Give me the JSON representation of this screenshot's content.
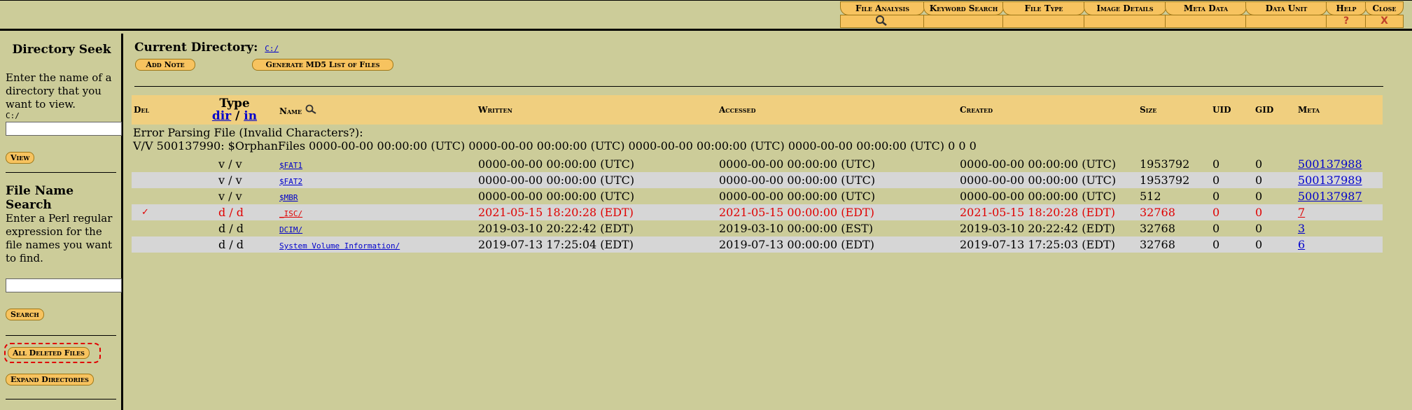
{
  "tabs": [
    {
      "label": "File Analysis",
      "sub": "search-icon"
    },
    {
      "label": "Keyword Search",
      "sub": ""
    },
    {
      "label": "File Type",
      "sub": ""
    },
    {
      "label": "Image Details",
      "sub": ""
    },
    {
      "label": "Meta Data",
      "sub": ""
    },
    {
      "label": "Data Unit",
      "sub": ""
    },
    {
      "label": "Help",
      "sub": "?"
    },
    {
      "label": "Close",
      "sub": "X"
    }
  ],
  "left": {
    "dir_seek_title": "Directory Seek",
    "dir_seek_text": "Enter the name of a directory that you want to view.",
    "dir_seek_path": "C:/",
    "view_button": "View",
    "file_search_title": "File Name Search",
    "file_search_text": "Enter a Perl regular expression for the file names you want to find.",
    "search_button": "Search",
    "all_deleted_button": "All Deleted Files",
    "expand_dirs_button": "Expand Directories"
  },
  "main": {
    "current_dir_label": "Current Directory:",
    "current_dir_link": "C:/",
    "add_note_button": "Add Note",
    "md5_button": "Generate MD5 List of Files",
    "columns": {
      "del": "Del",
      "type": "Type",
      "type_dir": "dir",
      "type_sep": "/",
      "type_in": "in",
      "name": "Name",
      "written": "Written",
      "accessed": "Accessed",
      "created": "Created",
      "size": "Size",
      "uid": "UID",
      "gid": "GID",
      "meta": "Meta"
    },
    "error_line1": "Error Parsing File (Invalid Characters?):",
    "error_line2": "V/V 500137990: $OrphanFiles 0000-00-00 00:00:00 (UTC) 0000-00-00 00:00:00 (UTC) 0000-00-00 00:00:00 (UTC) 0000-00-00 00:00:00 (UTC) 0 0 0",
    "rows": [
      {
        "del": "",
        "type": "v / v",
        "name": "$FAT1",
        "written": "0000-00-00 00:00:00  (UTC)",
        "accessed": "0000-00-00 00:00:00  (UTC)",
        "created": "0000-00-00 00:00:00  (UTC)",
        "size": "1953792",
        "uid": "0",
        "gid": "0",
        "meta": "500137988"
      },
      {
        "del": "",
        "type": "v / v",
        "name": "$FAT2",
        "written": "0000-00-00 00:00:00  (UTC)",
        "accessed": "0000-00-00 00:00:00  (UTC)",
        "created": "0000-00-00 00:00:00  (UTC)",
        "size": "1953792",
        "uid": "0",
        "gid": "0",
        "meta": "500137989"
      },
      {
        "del": "",
        "type": "v / v",
        "name": "$MBR",
        "written": "0000-00-00 00:00:00  (UTC)",
        "accessed": "0000-00-00 00:00:00  (UTC)",
        "created": "0000-00-00 00:00:00  (UTC)",
        "size": "512",
        "uid": "0",
        "gid": "0",
        "meta": "500137987"
      },
      {
        "del": "✓",
        "type": "d / d",
        "name": "_ISC/",
        "written": "2021-05-15 18:20:28  (EDT)",
        "accessed": "2021-05-15 00:00:00  (EDT)",
        "created": "2021-05-15 18:20:28  (EDT)",
        "size": "32768",
        "uid": "0",
        "gid": "0",
        "meta": "7"
      },
      {
        "del": "",
        "type": "d / d",
        "name": "DCIM/",
        "written": "2019-03-10 20:22:42  (EDT)",
        "accessed": "2019-03-10 00:00:00  (EST)",
        "created": "2019-03-10 20:22:42  (EDT)",
        "size": "32768",
        "uid": "0",
        "gid": "0",
        "meta": "3"
      },
      {
        "del": "",
        "type": "d / d",
        "name": "System Volume Information/",
        "written": "2019-07-13 17:25:04  (EDT)",
        "accessed": "2019-07-13 00:00:00  (EDT)",
        "created": "2019-07-13 17:25:03  (EDT)",
        "size": "32768",
        "uid": "0",
        "gid": "0",
        "meta": "6"
      }
    ]
  },
  "colors": {
    "background": "#cccc99",
    "button": "#f7c35f",
    "header": "#f0cf7f",
    "deleted": "#e00000",
    "link": "#0000cc"
  }
}
